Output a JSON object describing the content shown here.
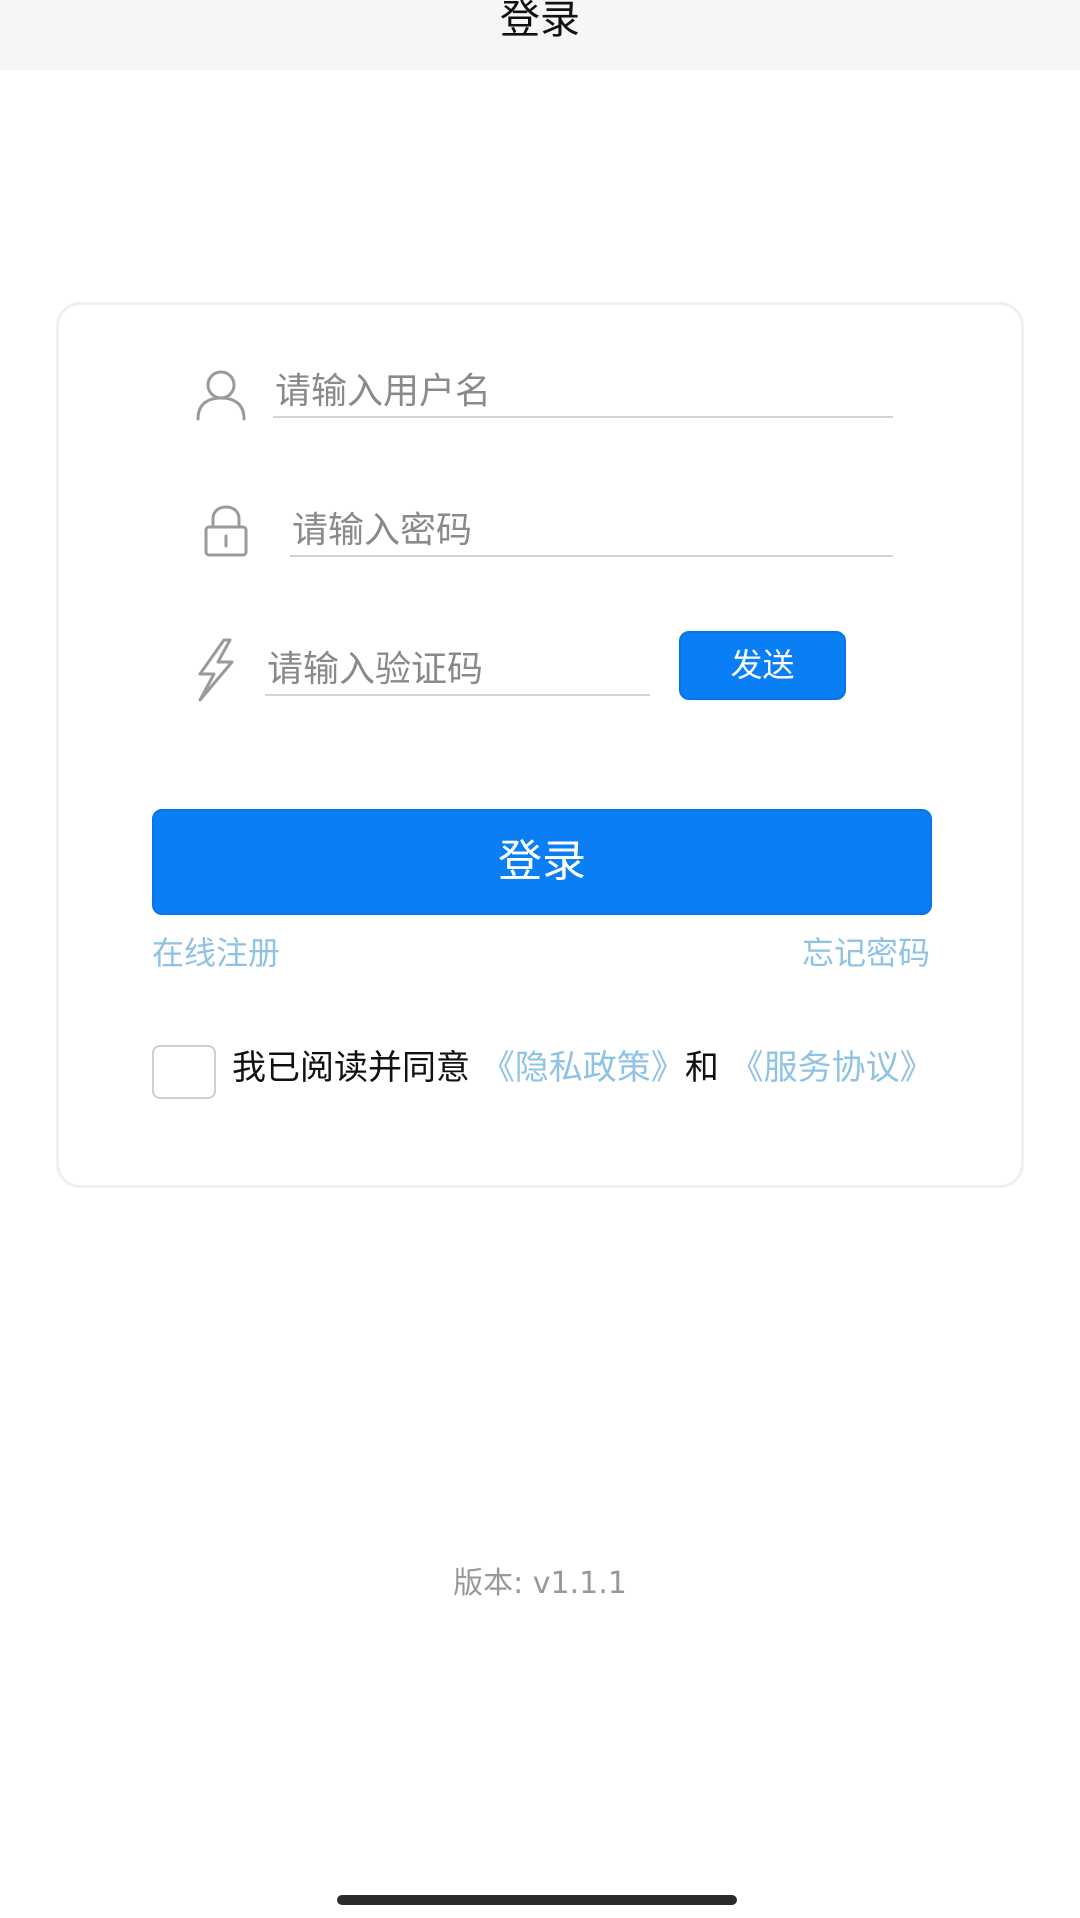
{
  "header": {
    "title": "登录"
  },
  "form": {
    "username_placeholder": "请输入用户名",
    "password_placeholder": "请输入密码",
    "code_placeholder": "请输入验证码",
    "send_label": "发送",
    "login_label": "登录",
    "register_link": "在线注册",
    "forgot_link": "忘记密码",
    "icons": {
      "username": "user-icon",
      "password": "lock-icon",
      "code": "lightning-icon"
    }
  },
  "agreement": {
    "prefix": "我已阅读并同意",
    "privacy_link": "《隐私政策》",
    "conjunction": "和",
    "service_link": "《服务协议》",
    "checked": false
  },
  "footer": {
    "version": "版本: v1.1.1"
  },
  "colors": {
    "primary": "#0a7ff5",
    "link": "#8fc3e6",
    "header_bg": "#f6f6f6"
  }
}
